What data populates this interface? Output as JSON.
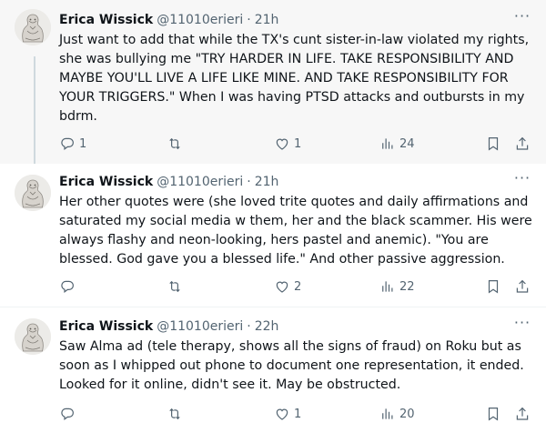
{
  "tweets": [
    {
      "name": "Erica Wissick",
      "handle": "@11010erieri",
      "dot": "·",
      "time": "21h",
      "text": "Just want to add that while the TX's cunt sister-in-law violated my rights, she was bullying me \"TRY HARDER IN LIFE. TAKE RESPONSIBILITY AND MAYBE YOU'LL LIVE A LIFE LIKE MINE. AND TAKE RESPONSIBILITY FOR YOUR TRIGGERS.\" When I was having PTSD attacks and outbursts in my bdrm.",
      "replies": "1",
      "reposts": "",
      "likes": "1",
      "views": "24"
    },
    {
      "name": "Erica Wissick",
      "handle": "@11010erieri",
      "dot": "·",
      "time": "21h",
      "text": "Her other quotes were (she loved trite quotes and daily affirmations and saturated my social media w them, her and the black scammer. His were always flashy and neon-looking, hers pastel and anemic). \"You are blessed. God gave you a blessed life.\" And other passive aggression.",
      "replies": "",
      "reposts": "",
      "likes": "2",
      "views": "22"
    },
    {
      "name": "Erica Wissick",
      "handle": "@11010erieri",
      "dot": "·",
      "time": "22h",
      "text": "Saw Alma ad (tele therapy, shows all the signs of fraud) on Roku but as soon as I whipped out phone to document one representation, it ended. Looked for it online, didn't see it. May be obstructed.",
      "replies": "",
      "reposts": "",
      "likes": "1",
      "views": "20"
    }
  ],
  "more_label": "···",
  "colors": {
    "text": "#0f1419",
    "secondary": "#536471",
    "highlight_bg": "#f7f7f7"
  },
  "icons": [
    "reply-icon",
    "repost-icon",
    "like-icon",
    "views-icon",
    "bookmark-icon",
    "share-icon",
    "more-icon"
  ]
}
